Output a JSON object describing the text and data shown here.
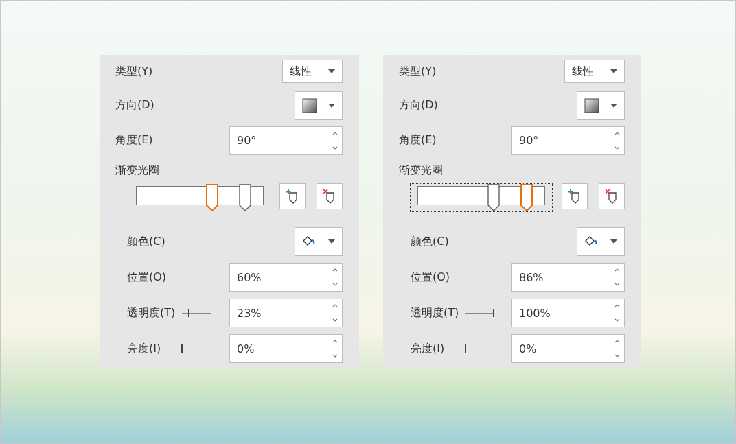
{
  "panels": [
    {
      "top_rows": [
        {
          "kind": "dropdown",
          "label": "类型(Y)",
          "value": "线性"
        },
        {
          "kind": "gradient-dropdown",
          "label": "方向(D)"
        },
        {
          "kind": "spinner",
          "label": "角度(E)",
          "value": "90°"
        }
      ],
      "section_label": "渐变光圈",
      "gradient": {
        "focused": false,
        "stops": [
          {
            "level": 0.6,
            "selected": true
          },
          {
            "level": 0.86,
            "selected": false
          }
        ]
      },
      "sub_rows": [
        {
          "kind": "color-dropdown",
          "label": "颜色(C)"
        },
        {
          "kind": "spinner",
          "label": "位置(O)",
          "value": "60%"
        },
        {
          "kind": "slider-spinner",
          "label": "透明度(T)",
          "value": "23%",
          "level": 0.23
        },
        {
          "kind": "slider-spinner",
          "label": "亮度(I)",
          "value": "0%",
          "level": 0.5
        }
      ]
    },
    {
      "top_rows": [
        {
          "kind": "dropdown",
          "label": "类型(Y)",
          "value": "线性"
        },
        {
          "kind": "gradient-dropdown",
          "label": "方向(D)"
        },
        {
          "kind": "spinner",
          "label": "角度(E)",
          "value": "90°"
        }
      ],
      "section_label": "渐变光圈",
      "gradient": {
        "focused": true,
        "stops": [
          {
            "level": 0.6,
            "selected": false
          },
          {
            "level": 0.86,
            "selected": true
          }
        ]
      },
      "sub_rows": [
        {
          "kind": "color-dropdown",
          "label": "颜色(C)"
        },
        {
          "kind": "spinner",
          "label": "位置(O)",
          "value": "86%"
        },
        {
          "kind": "slider-spinner",
          "label": "透明度(T)",
          "value": "100%",
          "level": 1
        },
        {
          "kind": "slider-spinner",
          "label": "亮度(I)",
          "value": "0%",
          "level": 0.5
        }
      ]
    }
  ]
}
